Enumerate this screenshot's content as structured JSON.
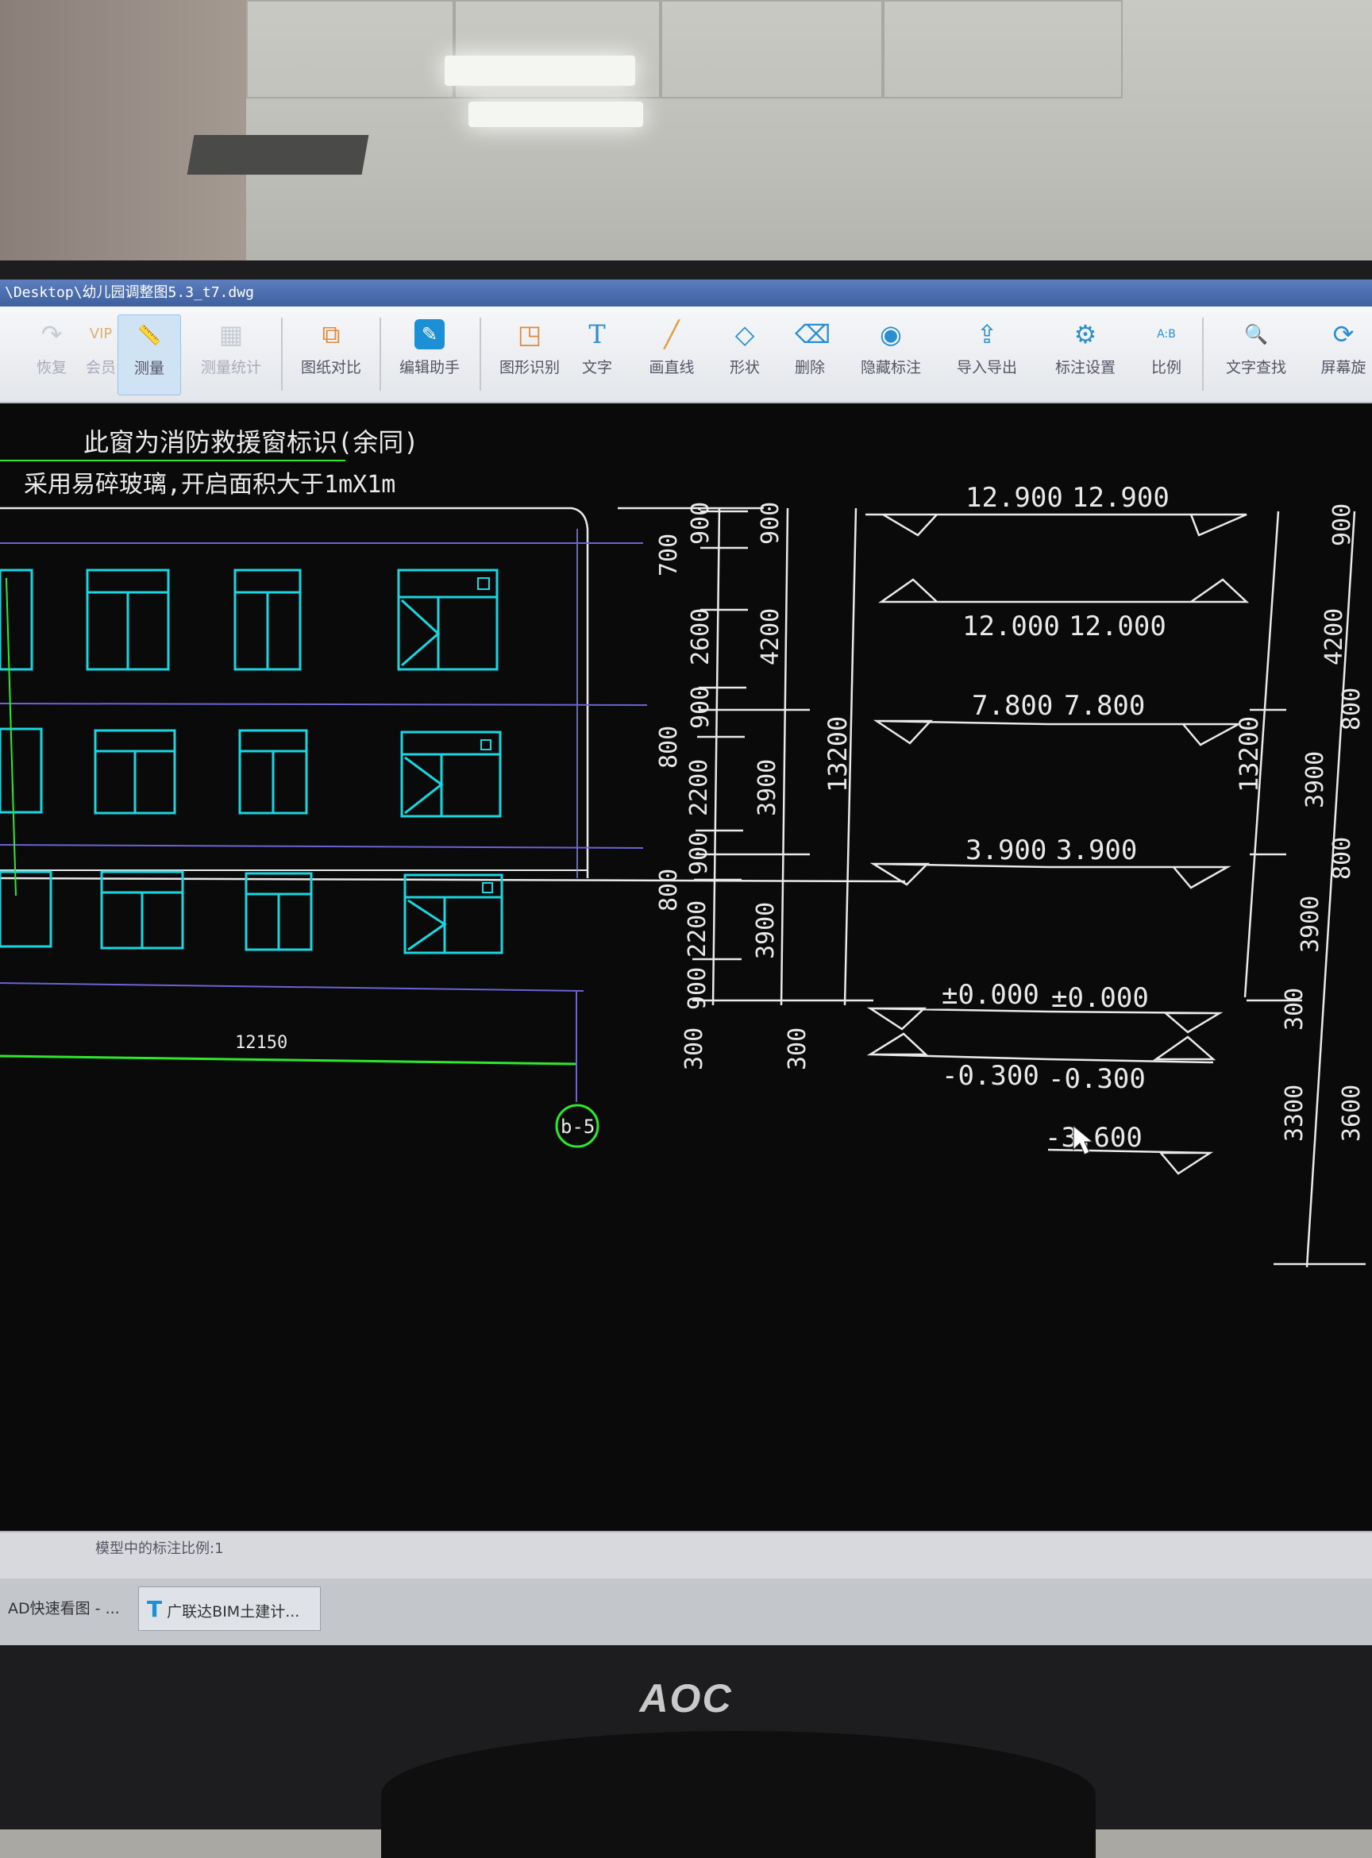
{
  "window": {
    "title": "\\Desktop\\幼儿园调整图5.3_t7.dwg"
  },
  "toolbar": {
    "items": [
      {
        "label": "恢复",
        "icon": "redo-icon",
        "glyph": "↷"
      },
      {
        "label": "会员",
        "icon": "vip-icon",
        "glyph": "VIP"
      },
      {
        "label": "测量",
        "icon": "ruler-icon",
        "glyph": "📏"
      },
      {
        "label": "测量统计",
        "icon": "measure-stats-icon",
        "glyph": "▦"
      },
      {
        "label": "图纸对比",
        "icon": "compare-icon",
        "glyph": "⧉"
      },
      {
        "label": "编辑助手",
        "icon": "edit-helper-icon",
        "glyph": "✎"
      },
      {
        "label": "图形识别",
        "icon": "shape-recognize-icon",
        "glyph": "◳"
      },
      {
        "label": "文字",
        "icon": "text-icon",
        "glyph": "T"
      },
      {
        "label": "画直线",
        "icon": "line-icon",
        "glyph": "╱"
      },
      {
        "label": "形状",
        "icon": "shape-icon",
        "glyph": "◇"
      },
      {
        "label": "删除",
        "icon": "eraser-icon",
        "glyph": "⌫"
      },
      {
        "label": "隐藏标注",
        "icon": "hide-annotation-icon",
        "glyph": "◉"
      },
      {
        "label": "导入导出",
        "icon": "import-export-icon",
        "glyph": "⇪"
      },
      {
        "label": "标注设置",
        "icon": "annotation-settings-icon",
        "glyph": "⚙"
      },
      {
        "label": "比例",
        "icon": "scale-icon",
        "glyph": "A:B"
      },
      {
        "label": "文字查找",
        "icon": "text-search-icon",
        "glyph": "🔍"
      },
      {
        "label": "屏幕旋",
        "icon": "screen-rotate-icon",
        "glyph": "⟳"
      }
    ]
  },
  "drawing": {
    "note_line1": "此窗为消防救援窗标识(余同)",
    "note_line2": "采用易碎玻璃,开启面积大于1mX1m",
    "dims_col1": [
      "900",
      "700",
      "2600",
      "900",
      "800",
      "2200",
      "900",
      "800",
      "2200",
      "900",
      "300"
    ],
    "dims_col2": [
      "900",
      "4200",
      "3900",
      "3900",
      "300"
    ],
    "dim_total_left": "13200",
    "dim_total_right": "13200",
    "dims_right": [
      "900",
      "4200",
      "800",
      "3900",
      "800",
      "3900",
      "300",
      "3300",
      "3600"
    ],
    "elevations": [
      {
        "left": "12.900",
        "right": "12.900"
      },
      {
        "left": "12.000",
        "right": "12.000"
      },
      {
        "left": "7.800",
        "right": "7.800"
      },
      {
        "left": "3.900",
        "right": "3.900"
      },
      {
        "left": "±0.000",
        "right": "±0.000"
      },
      {
        "left": "-0.300",
        "right": "-0.300"
      }
    ],
    "elevation_bottom": "-3.600",
    "bottom_dim": "12150",
    "axis_label": "b-5"
  },
  "statusbar": {
    "scale_text": "模型中的标注比例:1"
  },
  "taskbar": {
    "item1": "AD快速看图 - ...",
    "item2": "广联达BIM土建计..."
  },
  "monitor": {
    "brand": "AOC"
  },
  "colors": {
    "window_cyan": "#19d6e0",
    "dim_white": "#e9e9e9",
    "axis_green": "#2ee82e",
    "floor_line_purple": "#6b63d6"
  }
}
